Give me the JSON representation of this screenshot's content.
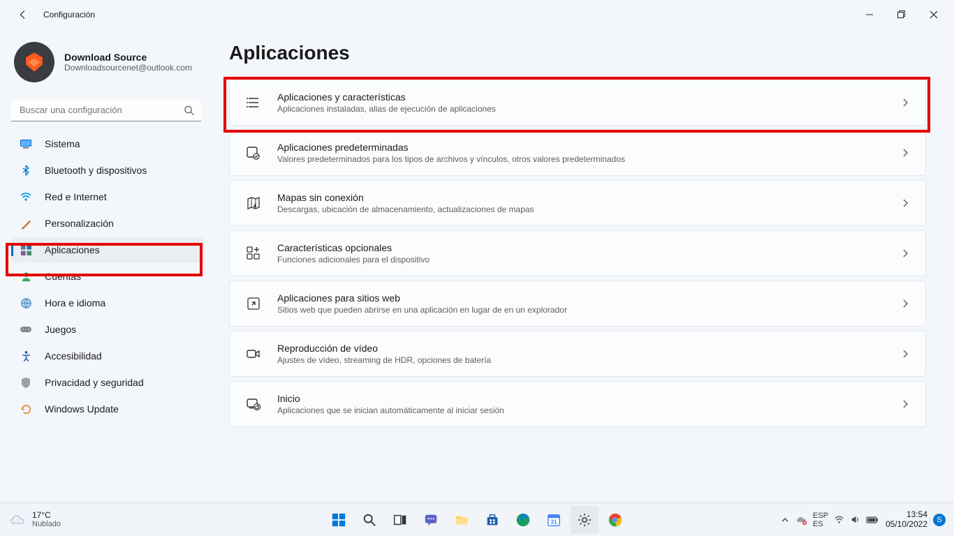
{
  "window": {
    "title": "Configuración"
  },
  "profile": {
    "name": "Download Source",
    "email": "Downloadsourcenet@outlook.com"
  },
  "search": {
    "placeholder": "Buscar una configuración"
  },
  "nav": {
    "items": [
      {
        "label": "Sistema",
        "icon": "monitor"
      },
      {
        "label": "Bluetooth y dispositivos",
        "icon": "bluetooth"
      },
      {
        "label": "Red e Internet",
        "icon": "wifi"
      },
      {
        "label": "Personalización",
        "icon": "brush"
      },
      {
        "label": "Aplicaciones",
        "icon": "apps",
        "active": true
      },
      {
        "label": "Cuentas",
        "icon": "person"
      },
      {
        "label": "Hora e idioma",
        "icon": "globe"
      },
      {
        "label": "Juegos",
        "icon": "gamepad"
      },
      {
        "label": "Accesibilidad",
        "icon": "accessibility"
      },
      {
        "label": "Privacidad y seguridad",
        "icon": "shield"
      },
      {
        "label": "Windows Update",
        "icon": "update"
      }
    ]
  },
  "main": {
    "title": "Aplicaciones",
    "cards": [
      {
        "title": "Aplicaciones y características",
        "sub": "Aplicaciones instaladas, alias de ejecución de aplicaciones",
        "highlight": true
      },
      {
        "title": "Aplicaciones predeterminadas",
        "sub": "Valores predeterminados para los tipos de archivos y vínculos, otros valores predeterminados"
      },
      {
        "title": "Mapas sin conexión",
        "sub": "Descargas, ubicación de almacenamiento, actualizaciones de mapas"
      },
      {
        "title": "Características opcionales",
        "sub": "Funciones adicionales para el dispositivo"
      },
      {
        "title": "Aplicaciones para sitios web",
        "sub": "Sitios web que pueden abrirse en una aplicación en lugar de en un explorador"
      },
      {
        "title": "Reproducción de vídeo",
        "sub": "Ajustes de vídeo, streaming de HDR, opciones de batería"
      },
      {
        "title": "Inicio",
        "sub": "Aplicaciones que se inician automáticamente al iniciar sesión"
      }
    ]
  },
  "taskbar": {
    "weather": {
      "temp": "17°C",
      "condition": "Nublado"
    },
    "time": "13:54",
    "date": "05/10/2022",
    "user_initial": "S"
  },
  "colors": {
    "accent": "#0067c0",
    "highlight": "#e60000",
    "avatar_accent": "#ff5b1f"
  }
}
